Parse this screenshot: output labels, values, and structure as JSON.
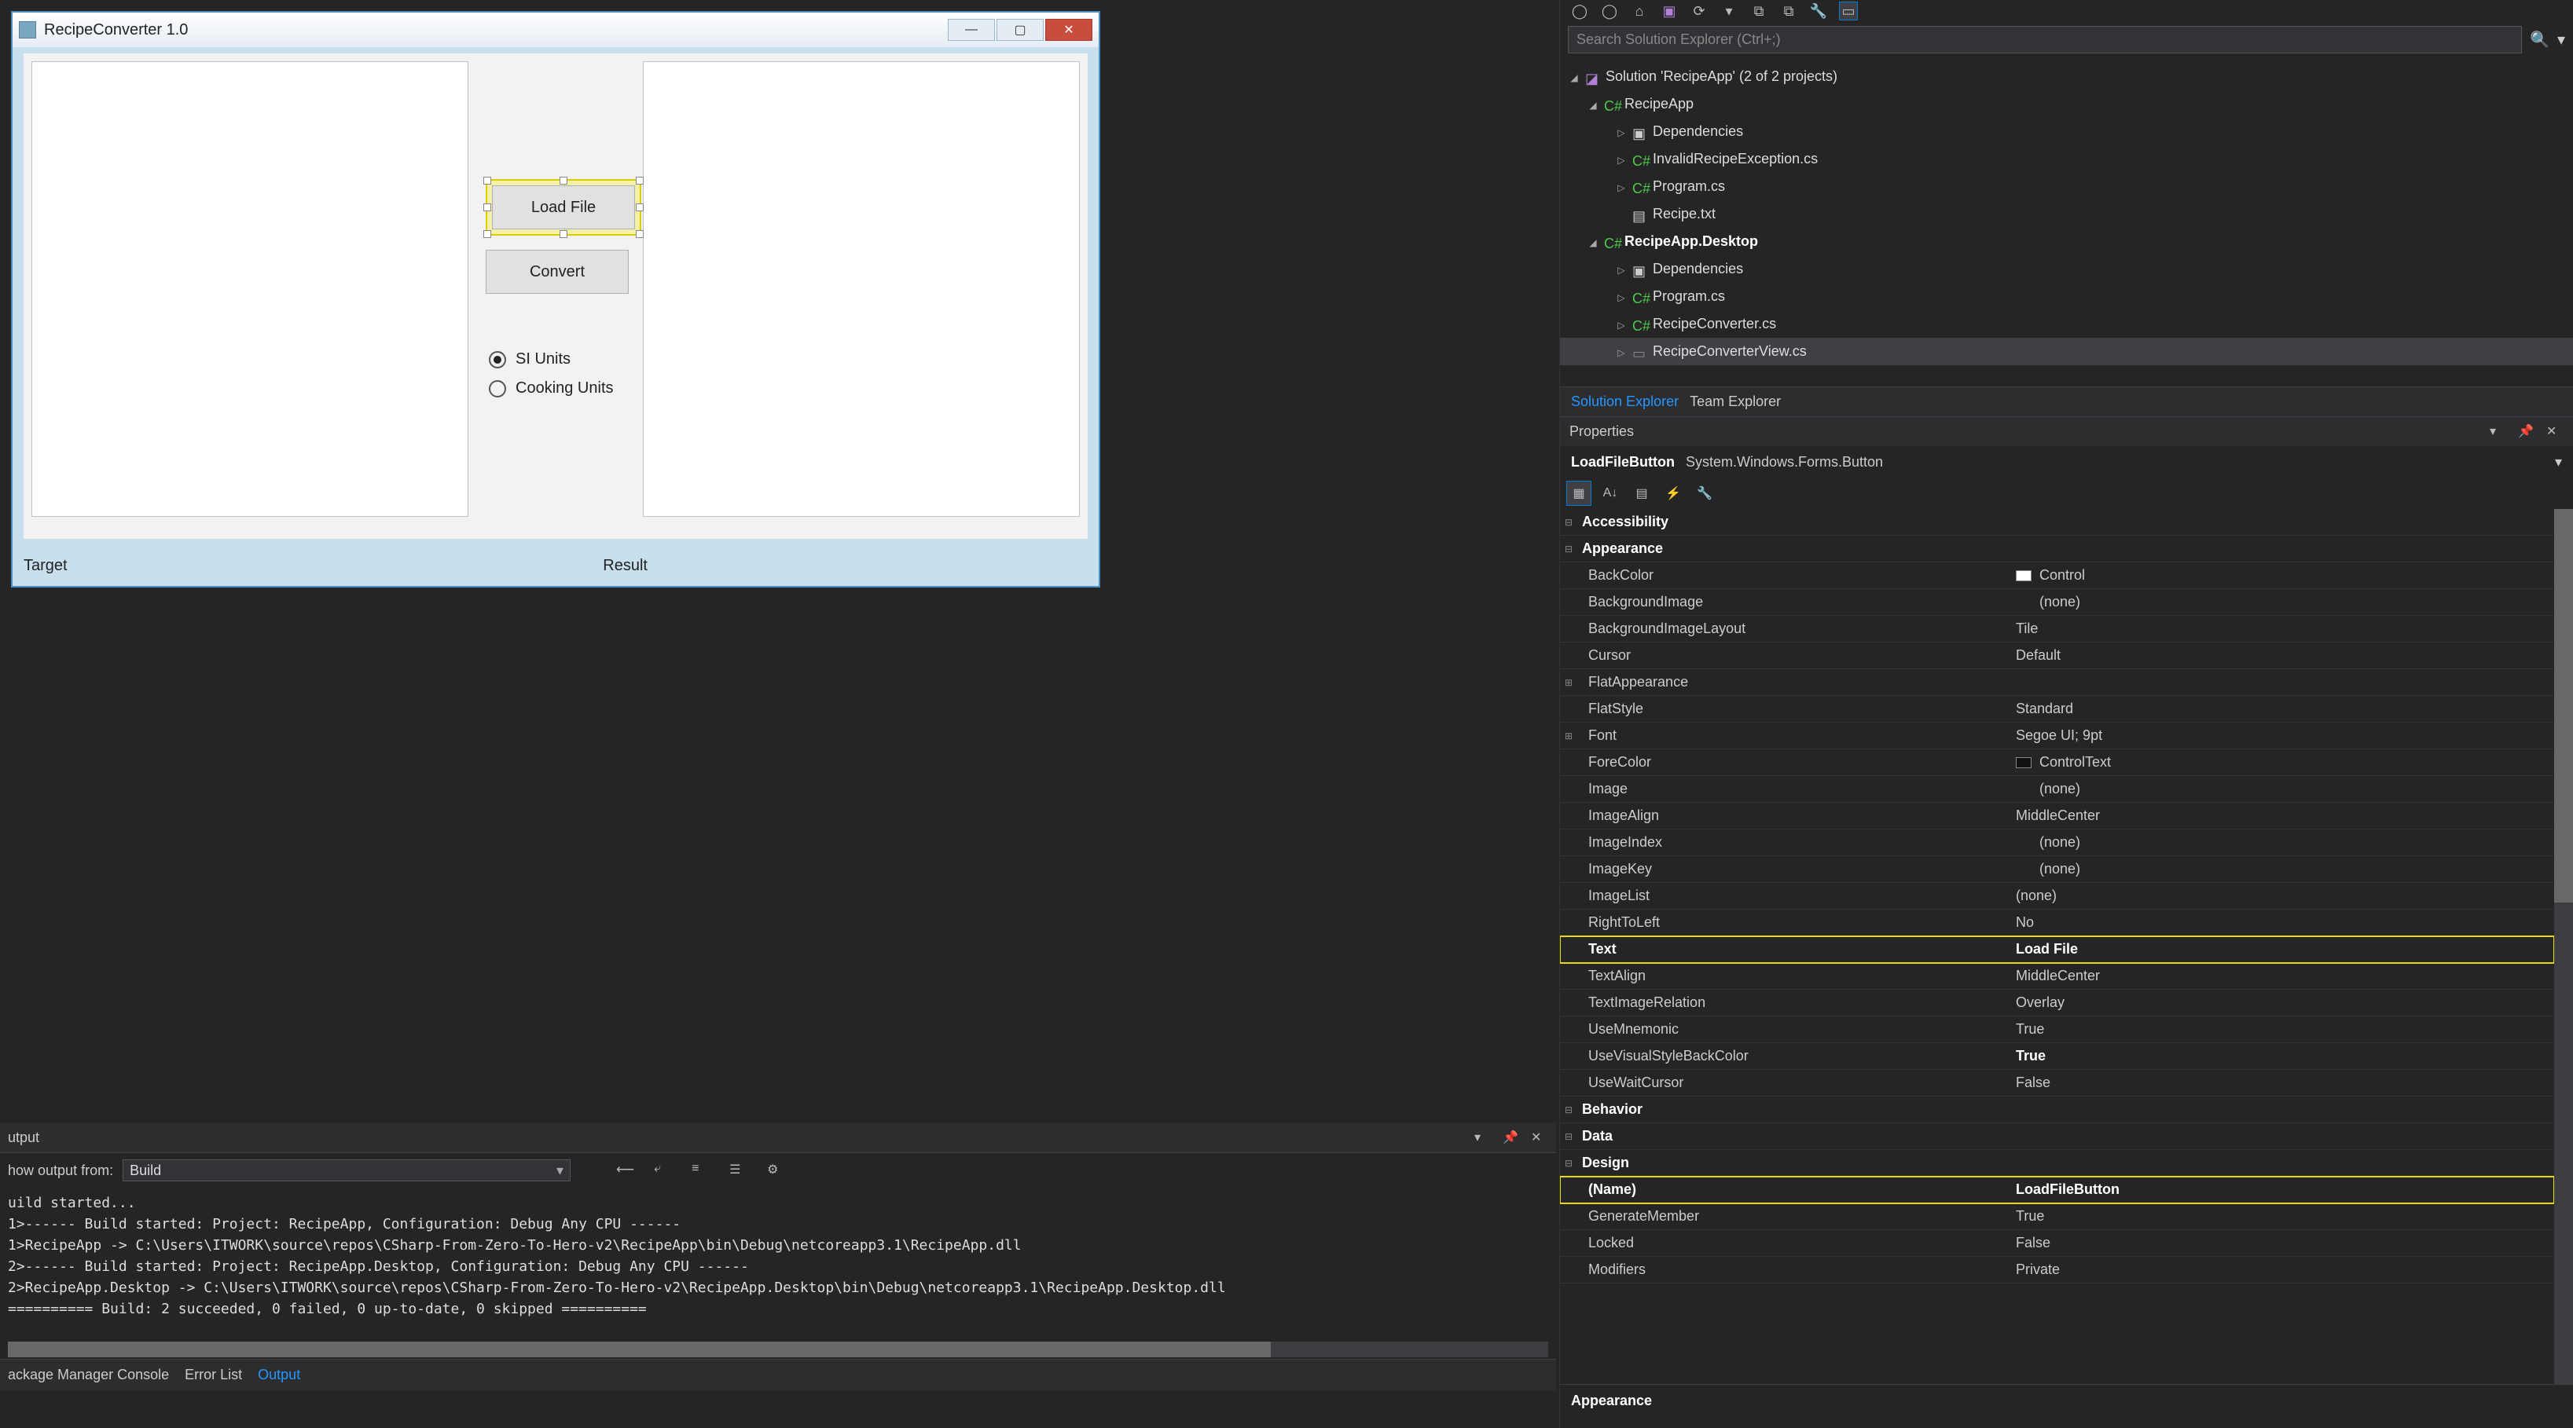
{
  "designer": {
    "title": "RecipeConverter 1.0",
    "load_btn": "Load File",
    "convert_btn": "Convert",
    "radio_si": "SI Units",
    "radio_cook": "Cooking Units",
    "label_target": "Target",
    "label_result": "Result"
  },
  "output": {
    "title": "utput",
    "show_from_label": "how output from:",
    "show_from_value": "Build",
    "lines": [
      "uild started...",
      "1>------ Build started: Project: RecipeApp, Configuration: Debug Any CPU ------",
      "1>RecipeApp -> C:\\Users\\ITWORK\\source\\repos\\CSharp-From-Zero-To-Hero-v2\\RecipeApp\\bin\\Debug\\netcoreapp3.1\\RecipeApp.dll",
      "2>------ Build started: Project: RecipeApp.Desktop, Configuration: Debug Any CPU ------",
      "2>RecipeApp.Desktop -> C:\\Users\\ITWORK\\source\\repos\\CSharp-From-Zero-To-Hero-v2\\RecipeApp.Desktop\\bin\\Debug\\netcoreapp3.1\\RecipeApp.Desktop.dll",
      "========== Build: 2 succeeded, 0 failed, 0 up-to-date, 0 skipped =========="
    ],
    "tab_pkg": "ackage Manager Console",
    "tab_err": "Error List",
    "tab_out": "Output"
  },
  "sln": {
    "search_placeholder": "Search Solution Explorer (Ctrl+;)",
    "root": "Solution 'RecipeApp' (2 of 2 projects)",
    "proj1": "RecipeApp",
    "p1_dep": "Dependencies",
    "p1_f1": "InvalidRecipeException.cs",
    "p1_f2": "Program.cs",
    "p1_f3": "Recipe.txt",
    "proj2": "RecipeApp.Desktop",
    "p2_dep": "Dependencies",
    "p2_f1": "Program.cs",
    "p2_f2": "RecipeConverter.cs",
    "p2_f3": "RecipeConverterView.cs",
    "tab_sln": "Solution Explorer",
    "tab_team": "Team Explorer"
  },
  "props": {
    "panel_title": "Properties",
    "obj_name": "LoadFileButton",
    "obj_type": "System.Windows.Forms.Button",
    "cat_access": "Accessibility",
    "cat_appear": "Appearance",
    "BackColor": "Control",
    "BackgroundImage": "(none)",
    "BackgroundImageLayout": "Tile",
    "Cursor": "Default",
    "FlatAppearance": "",
    "FlatStyle": "Standard",
    "Font": "Segoe UI; 9pt",
    "ForeColor": "ControlText",
    "Image": "(none)",
    "ImageAlign": "MiddleCenter",
    "ImageIndex": "(none)",
    "ImageKey": "(none)",
    "ImageList": "(none)",
    "RightToLeft": "No",
    "Text_k": "Text",
    "Text_v": "Load File",
    "TextAlign": "MiddleCenter",
    "TextImageRelation": "Overlay",
    "UseMnemonic": "True",
    "UseVisualStyleBackColor_k": "UseVisualStyleBackColor",
    "UseVisualStyleBackColor_v": "True",
    "UseWaitCursor": "False",
    "cat_behavior": "Behavior",
    "cat_data": "Data",
    "cat_design": "Design",
    "Name_k": "(Name)",
    "Name_v": "LoadFileButton",
    "GenerateMember": "True",
    "Locked": "False",
    "Modifiers_k": "Modifiers",
    "Modifiers_v": "Private",
    "footer": "Appearance"
  }
}
